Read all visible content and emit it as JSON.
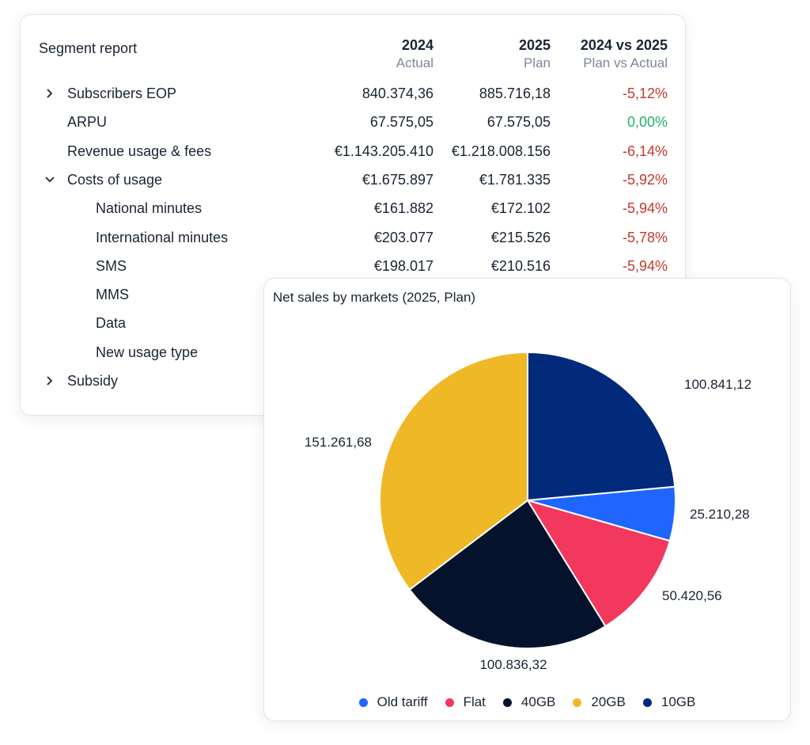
{
  "report": {
    "title": "Segment report",
    "columns": [
      {
        "main": "2024",
        "sub": "Actual"
      },
      {
        "main": "2025",
        "sub": "Plan"
      },
      {
        "main": "2024 vs 2025",
        "sub": "Plan vs Actual"
      }
    ],
    "rows": [
      {
        "label": "Subscribers EOP",
        "chevron": "chevron-right",
        "indent": 0,
        "v2024": "840.374,36",
        "v2025": "885.716,18",
        "diff": "-5,12%",
        "diff_tone": "neg"
      },
      {
        "label": "ARPU",
        "chevron": "",
        "indent": 0,
        "v2024": "67.575,05",
        "v2025": "67.575,05",
        "diff": "0,00%",
        "diff_tone": "pos"
      },
      {
        "label": "Revenue usage & fees",
        "chevron": "",
        "indent": 0,
        "v2024": "€1.143.205.410",
        "v2025": "€1.218.008.156",
        "diff": "-6,14%",
        "diff_tone": "neg"
      },
      {
        "label": "Costs of usage",
        "chevron": "chevron-down",
        "indent": 0,
        "v2024": "€1.675.897",
        "v2025": "€1.781.335",
        "diff": "-5,92%",
        "diff_tone": "neg"
      },
      {
        "label": "National minutes",
        "chevron": "",
        "indent": 1,
        "v2024": "€161.882",
        "v2025": "€172.102",
        "diff": "-5,94%",
        "diff_tone": "neg"
      },
      {
        "label": "International minutes",
        "chevron": "",
        "indent": 1,
        "v2024": "€203.077",
        "v2025": "€215.526",
        "diff": "-5,78%",
        "diff_tone": "neg"
      },
      {
        "label": "SMS",
        "chevron": "",
        "indent": 1,
        "v2024": "€198.017",
        "v2025": "€210.516",
        "diff": "-5,94%",
        "diff_tone": "neg"
      },
      {
        "label": "MMS",
        "chevron": "",
        "indent": 1,
        "v2024": "",
        "v2025": "",
        "diff": "",
        "diff_tone": ""
      },
      {
        "label": "Data",
        "chevron": "",
        "indent": 1,
        "v2024": "",
        "v2025": "",
        "diff": "",
        "diff_tone": ""
      },
      {
        "label": "New usage type",
        "chevron": "",
        "indent": 1,
        "v2024": "",
        "v2025": "",
        "diff": "",
        "diff_tone": ""
      },
      {
        "label": "Subsidy",
        "chevron": "chevron-right",
        "indent": 0,
        "v2024": "",
        "v2025": "",
        "diff": "",
        "diff_tone": ""
      }
    ],
    "colors": {
      "negative": "#c23a2b",
      "positive": "#1fb36a"
    }
  },
  "chart_data": {
    "type": "pie",
    "title": "Net sales by markets (2025, Plan)",
    "slices": [
      {
        "name": "10GB",
        "value": 100841.12,
        "label": "100.841,12",
        "color": "#022a7b"
      },
      {
        "name": "Old tariff",
        "value": 25210.28,
        "label": "25.210,28",
        "color": "#1f66ff"
      },
      {
        "name": "Flat",
        "value": 50420.56,
        "label": "50.420,56",
        "color": "#f2385c"
      },
      {
        "name": "40GB",
        "value": 100836.32,
        "label": "100.836,32",
        "color": "#04122b"
      },
      {
        "name": "20GB",
        "value": 151261.68,
        "label": "151.261,68",
        "color": "#efb827"
      }
    ],
    "legend": [
      "Old tariff",
      "Flat",
      "40GB",
      "20GB",
      "10GB"
    ],
    "legend_position": "bottom",
    "start_angle": "12 o'clock, clockwise"
  }
}
